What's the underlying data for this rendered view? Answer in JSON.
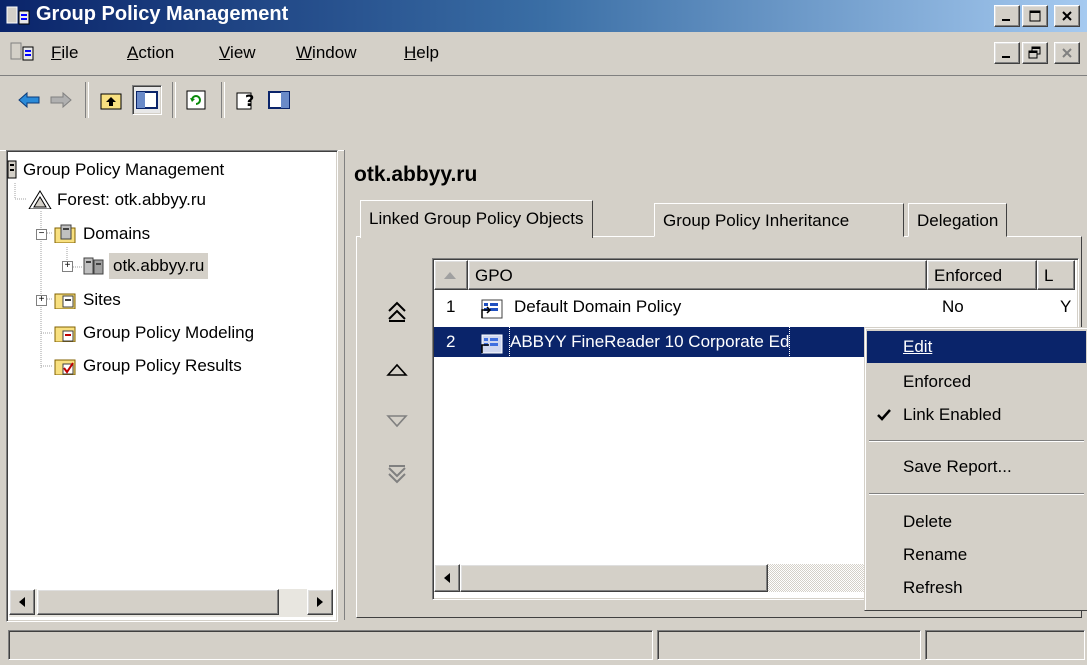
{
  "window": {
    "title": "Group Policy Management"
  },
  "menu": {
    "items": [
      {
        "label": "File",
        "u": "F",
        "rest": "ile"
      },
      {
        "label": "Action",
        "u": "A",
        "rest": "ction"
      },
      {
        "label": "View",
        "u": "V",
        "rest": "iew"
      },
      {
        "label": "Window",
        "u": "W",
        "rest": "indow"
      },
      {
        "label": "Help",
        "u": "H",
        "rest": "elp"
      }
    ]
  },
  "tree": {
    "root": "Group Policy Management",
    "forest": "Forest: otk.abbyy.ru",
    "domains": "Domains",
    "domain": "otk.abbyy.ru",
    "sites": "Sites",
    "modeling": "Group Policy Modeling",
    "results": "Group Policy Results"
  },
  "main": {
    "title": "otk.abbyy.ru",
    "tabs": [
      "Linked Group Policy Objects",
      "Group Policy Inheritance",
      "Delegation"
    ],
    "columns": {
      "gpo": "GPO",
      "enforced": "Enforced",
      "link": "L"
    },
    "rows": [
      {
        "order": "1",
        "name": "Default Domain Policy",
        "enforced": "No",
        "link": "Y"
      },
      {
        "order": "2",
        "name": "ABBYY FineReader 10 Corporate Ed"
      }
    ]
  },
  "context_menu": {
    "edit": "Edit",
    "enforced": "Enforced",
    "link_enabled": "Link Enabled",
    "save_report": "Save Report...",
    "delete": "Delete",
    "rename": "Rename",
    "refresh": "Refresh"
  },
  "colors": {
    "selection": "#0a246a",
    "face": "#d4d0c8"
  }
}
